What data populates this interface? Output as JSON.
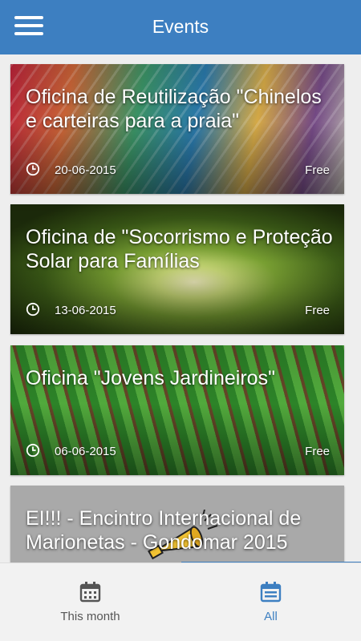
{
  "app_bar": {
    "title": "Events",
    "menu_icon": "menu-icon"
  },
  "events": [
    {
      "title": "Oficina de Reutilização \"Chinelos e carteiras para a praia\"",
      "date": "20-06-2015",
      "price": "Free",
      "image": "colored-threads"
    },
    {
      "title": "Oficina de \"Socorrismo e Proteção Solar para Famílias",
      "date": "13-06-2015",
      "price": "Free",
      "image": "forest-sunlight"
    },
    {
      "title": "Oficina \"Jovens Jardineiros\"",
      "date": "06-06-2015",
      "price": "Free",
      "image": "crop-field"
    },
    {
      "title": "EI!!! - Encintro Internacional de Marionetas - Gondomar 2015",
      "date": "",
      "price": "",
      "image": "megaphone"
    }
  ],
  "bottom_nav": {
    "tabs": [
      {
        "label": "This month",
        "icon": "calendar-icon",
        "active": false
      },
      {
        "label": "All",
        "icon": "calendar-list-icon",
        "active": true
      }
    ]
  },
  "colors": {
    "primary": "#3d7fc1",
    "bottom_bar_bg": "#f2f2f2",
    "inactive_tab": "#555555"
  }
}
